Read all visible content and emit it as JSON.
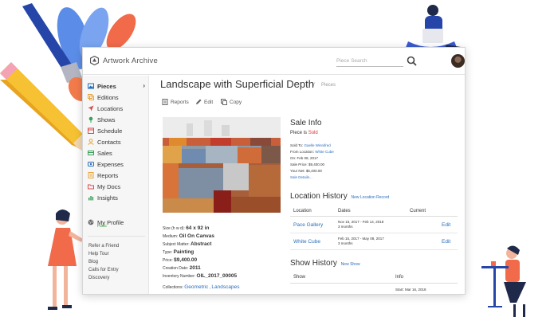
{
  "app": {
    "name": "Artwork Archive",
    "search_placeholder": "Piece Search"
  },
  "sidebar": {
    "items": [
      {
        "label": "Pieces",
        "icon": "image-icon",
        "color": "#2a6ebb"
      },
      {
        "label": "Editions",
        "icon": "editions-icon",
        "color": "#e8a33a"
      },
      {
        "label": "Locations",
        "icon": "location-arrow-icon",
        "color": "#d94b4b"
      },
      {
        "label": "Shows",
        "icon": "map-pin-icon",
        "color": "#3aa05a"
      },
      {
        "label": "Schedule",
        "icon": "calendar-icon",
        "color": "#d94b4b"
      },
      {
        "label": "Contacts",
        "icon": "contact-icon",
        "color": "#e8a33a"
      },
      {
        "label": "Sales",
        "icon": "sales-icon",
        "color": "#3aa05a"
      },
      {
        "label": "Expenses",
        "icon": "expenses-icon",
        "color": "#2a6ebb"
      },
      {
        "label": "Reports",
        "icon": "reports-icon",
        "color": "#e8a33a"
      },
      {
        "label": "My Docs",
        "icon": "folder-icon",
        "color": "#d94b4b"
      },
      {
        "label": "Insights",
        "icon": "bar-chart-icon",
        "color": "#3aa05a"
      }
    ],
    "profile": {
      "label": "My Profile",
      "status": "Public"
    },
    "links": [
      "Refer a Friend",
      "Help Tour",
      "Blog",
      "Calls for Entry",
      "Discovery"
    ]
  },
  "page": {
    "title": "Landscape with Superficial Depth",
    "breadcrumb_sep": "/",
    "breadcrumb": "Pieces",
    "actions": [
      "Reports",
      "Edit",
      "Copy"
    ]
  },
  "details": {
    "size_label": "Size (h w d):",
    "size_value": "64 x 92 in",
    "medium_label": "Medium:",
    "medium_value": "Oil On Canvas",
    "subject_label": "Subject Matter:",
    "subject_value": "Abstract",
    "type_label": "Type:",
    "type_value": "Painting",
    "price_label": "Price:",
    "price_value": "$9,400.00",
    "creation_label": "Creation Date:",
    "creation_value": "2011",
    "inventory_label": "Inventory Number:",
    "inventory_value": "OIL_2017_00005",
    "collections_label": "Collections:",
    "collection_1": "Geometric",
    "collections_sep": ",",
    "collection_2": "Landscapes"
  },
  "sale": {
    "heading": "Sale Info",
    "status_prefix": "Piece is",
    "status": "Sold",
    "sold_to_label": "Sold To:",
    "sold_to": "Gaelle Winnifred",
    "from_label": "From Location:",
    "from": "White Cube",
    "on_label": "On:",
    "on": "Feb 08, 2017",
    "price_label": "Sale Price:",
    "price": "$9,400.00",
    "net_label": "Your Net:",
    "net": "$6,400.00",
    "details_link": "Sale Details..."
  },
  "location_history": {
    "heading": "Location History",
    "new_link": "New Location Record",
    "columns": [
      "Location",
      "Dates",
      "Current"
    ],
    "rows": [
      {
        "location": "Pace Gallery",
        "dates": "Nov 15, 2017 - Feb 14, 2018",
        "duration": "3 months",
        "action": "Edit"
      },
      {
        "location": "White Cube",
        "dates": "Feb 15, 2017 - May 08, 2017",
        "duration": "3 months",
        "action": "Edit"
      }
    ]
  },
  "show_history": {
    "heading": "Show History",
    "new_link": "New Show",
    "columns": [
      "Show",
      "Info"
    ],
    "start": "Start: Mar 16, 2018"
  },
  "colors": {
    "link": "#2a6ebb",
    "sold": "#d33333",
    "public": "#3a9a3a"
  }
}
